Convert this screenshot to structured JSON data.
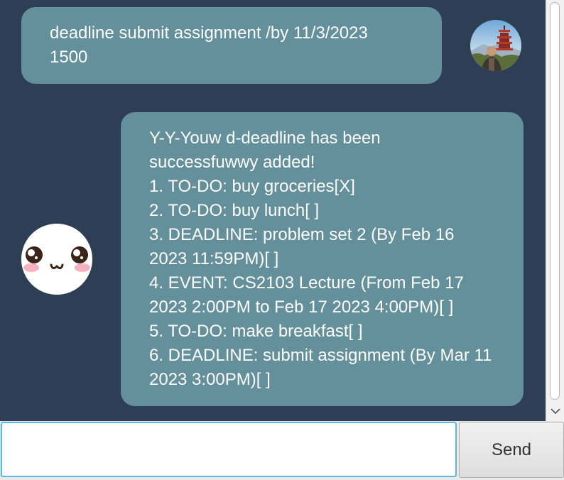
{
  "messages": {
    "user": {
      "text": "deadline submit assignment /by 11/3/2023\n1500"
    },
    "bot": {
      "text": "Y-Y-Youw d-deadline has been\nsuccessfuwwy added!\n1. TO-DO: buy groceries[X]\n2. TO-DO: buy lunch[ ]\n3. DEADLINE: problem set 2 (By Feb 16\n2023 11:59PM)[ ]\n4. EVENT: CS2103 Lecture (From Feb 17\n2023 2:00PM to Feb 17 2023 4:00PM)[ ]\n5. TO-DO: make breakfast[ ]\n6. DEADLINE: submit assignment (By Mar 11\n2023 3:00PM)[ ]"
    }
  },
  "input": {
    "value": "",
    "placeholder": ""
  },
  "send_button": {
    "label": "Send"
  },
  "colors": {
    "background": "#2e3f55",
    "bubble": "#63909b",
    "input_focus": "#56b9ea"
  },
  "icons": {
    "scroll_down": "chevron-down-icon",
    "user_avatar": "user-avatar-photo",
    "bot_avatar": "kawaii-face-avatar"
  }
}
